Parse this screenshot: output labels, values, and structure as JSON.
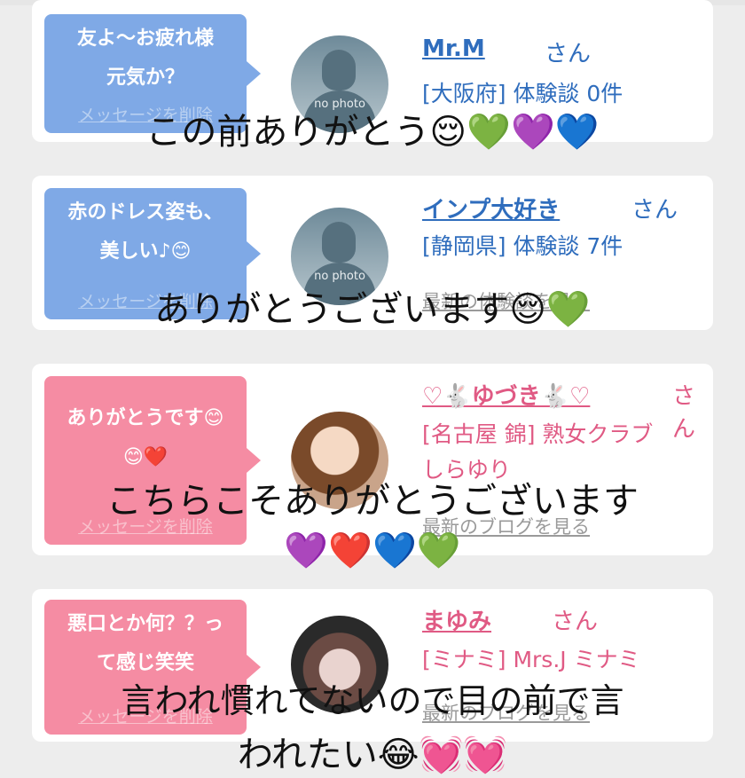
{
  "cards": [
    {
      "bubble_text": "友よ〜お疲れ様\n元気か？",
      "bubble_delete": "メッセージを削除",
      "name": "Mr.M",
      "san": "さん",
      "info": "[大阪府] 体験談 0件",
      "blog": "",
      "avatar_label": "no photo"
    },
    {
      "bubble_text": "赤のドレス姿も、\n美しい♪😊",
      "bubble_delete": "メッセージを削除",
      "name": "インプ大好き",
      "san": "さん",
      "info": "[静岡県] 体験談 7件",
      "blog": "最新の体験談を見る",
      "avatar_label": "no photo"
    },
    {
      "bubble_text": "ありがとうです😊\n😊❤️",
      "bubble_delete": "メッセージを削除",
      "name": "♡🐇ゆづき🐇♡",
      "san": "さん",
      "info": "[名古屋 錦] 熟女クラブ\nしらゆり",
      "blog": "最新のブログを見る"
    },
    {
      "bubble_text": "悪口とか何？？っ\nて感じ笑笑",
      "bubble_delete": "メッセージを削除",
      "name": "まゆみ",
      "san": "さん",
      "info": "[ミナミ] Mrs.J ミナミ",
      "blog": "最新のブログを見る"
    }
  ],
  "captions": {
    "c1": "この前ありがとう😌💚💜💙",
    "c2": "ありがとうございます😌💚",
    "c3a": "こちらこそありがとうございます",
    "c3b": "💜❤️💙💚",
    "c4a": "言われ慣れてないので目の前で言",
    "c4b": "われたい😂💓💓"
  },
  "colors": {
    "blue_bubble": "#7fa9e6",
    "pink_bubble": "#f58ca3",
    "blue_text": "#2f6dbd",
    "pink_text": "#e05a84"
  }
}
